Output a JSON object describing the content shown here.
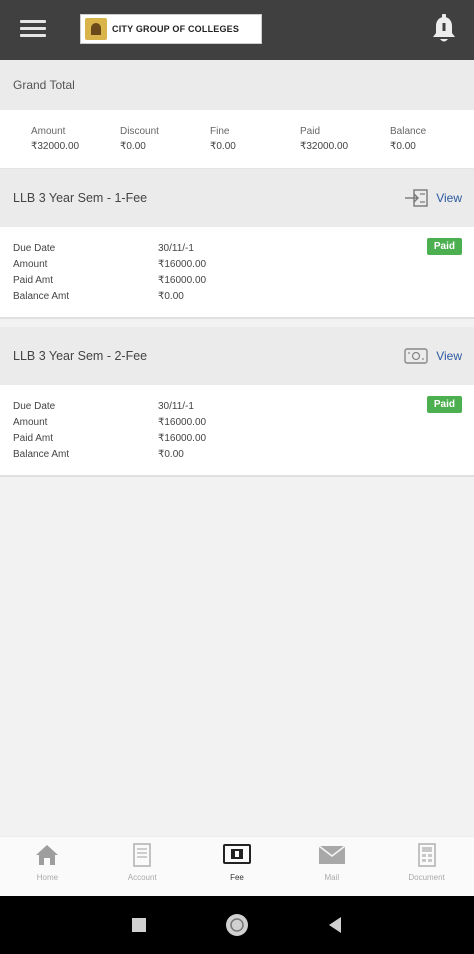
{
  "header": {
    "logo_text": "CITY GROUP OF COLLEGES",
    "menu_icon": "hamburger-icon",
    "bell_icon": "bell-icon"
  },
  "grand_total": {
    "title": "Grand Total",
    "columns": [
      {
        "label": "Amount",
        "value": "₹32000.00"
      },
      {
        "label": "Discount",
        "value": "₹0.00"
      },
      {
        "label": "Fine",
        "value": "₹0.00"
      },
      {
        "label": "Paid",
        "value": "₹32000.00"
      },
      {
        "label": "Balance",
        "value": "₹0.00"
      }
    ]
  },
  "fees": [
    {
      "title": "LLB 3 Year Sem - 1-Fee",
      "view_label": "View",
      "status": "Paid",
      "rows": [
        {
          "label": "Due Date",
          "value": "30/11/-1"
        },
        {
          "label": "Amount",
          "value": "₹16000.00"
        },
        {
          "label": "Paid Amt",
          "value": "₹16000.00"
        },
        {
          "label": "Balance Amt",
          "value": "₹0.00"
        }
      ]
    },
    {
      "title": "LLB 3 Year Sem - 2-Fee",
      "view_label": "View",
      "status": "Paid",
      "rows": [
        {
          "label": "Due Date",
          "value": "30/11/-1"
        },
        {
          "label": "Amount",
          "value": "₹16000.00"
        },
        {
          "label": "Paid Amt",
          "value": "₹16000.00"
        },
        {
          "label": "Balance Amt",
          "value": "₹0.00"
        }
      ]
    }
  ],
  "bottom_nav": [
    {
      "label": "Home",
      "icon": "home-icon"
    },
    {
      "label": "Account",
      "icon": "account-icon"
    },
    {
      "label": "Fee",
      "icon": "fee-icon",
      "active": true
    },
    {
      "label": "Mail",
      "icon": "mail-icon"
    },
    {
      "label": "Document",
      "icon": "document-icon"
    }
  ],
  "colors": {
    "topbar": "#404040",
    "paid": "#4caf50",
    "link": "#2c5aa0"
  }
}
